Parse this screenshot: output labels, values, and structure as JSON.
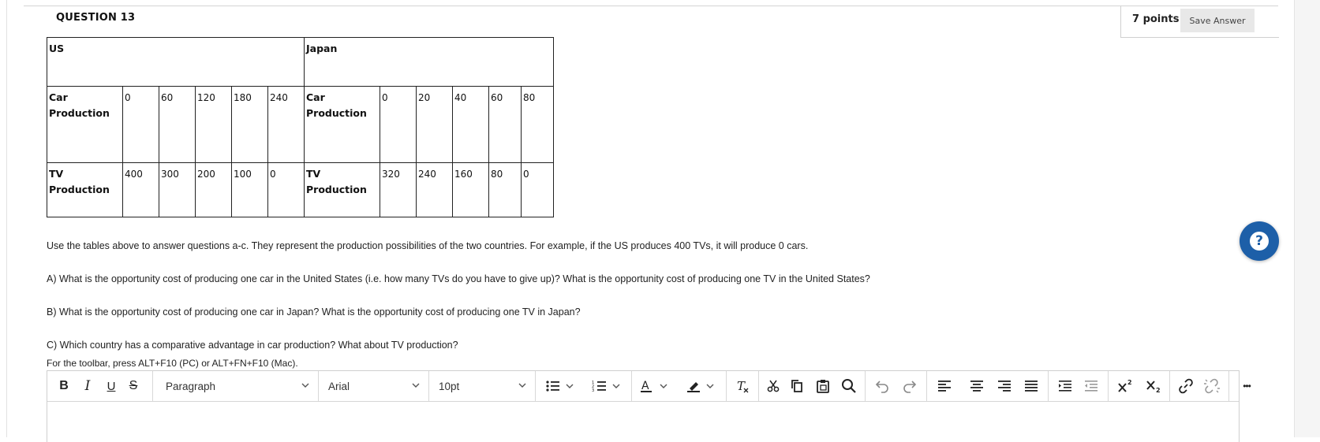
{
  "question": {
    "title": "QUESTION 13",
    "points": "7 points",
    "save_label": "Save Answer"
  },
  "table": {
    "us_header": "US",
    "japan_header": "Japan",
    "us_car_label": "Car Production",
    "us_car_values": [
      "0",
      "60",
      "120",
      "180",
      "240"
    ],
    "us_tv_label": "TV Production",
    "us_tv_values": [
      "400",
      "300",
      "200",
      "100",
      "0"
    ],
    "japan_car_label": "Car Production",
    "japan_car_values": [
      "0",
      "20",
      "40",
      "60",
      "80"
    ],
    "japan_tv_label": "TV Production",
    "japan_tv_values": [
      "320",
      "240",
      "160",
      "80",
      "0"
    ]
  },
  "text": {
    "intro": "Use the tables above to answer questions a-c. They represent the production possibilities of the two countries. For example, if the US produces 400 TVs, it will produce 0 cars.",
    "a": "A) What is the opportunity cost of producing one car in the United States (i.e. how many TVs do you have to give up)? What is the opportunity cost of producing one TV in the United States?",
    "b": "B) What is the opportunity cost of producing one car in Japan? What is the opportunity cost of producing one TV in Japan?",
    "c": "C) Which country has a comparative advantage in car production? What about TV production?",
    "toolbar_hint": "For the toolbar, press ALT+F10 (PC) or ALT+FN+F10 (Mac)."
  },
  "editor": {
    "bold": "B",
    "italic": "I",
    "underline": "U",
    "strike": "S",
    "block_format": "Paragraph",
    "font_family": "Arial",
    "font_size": "10pt",
    "more": "•••"
  },
  "icons": {
    "help": "?"
  },
  "colors": {
    "help_button": "#1d5fa8",
    "save_button_bg": "#e8e8e8"
  }
}
